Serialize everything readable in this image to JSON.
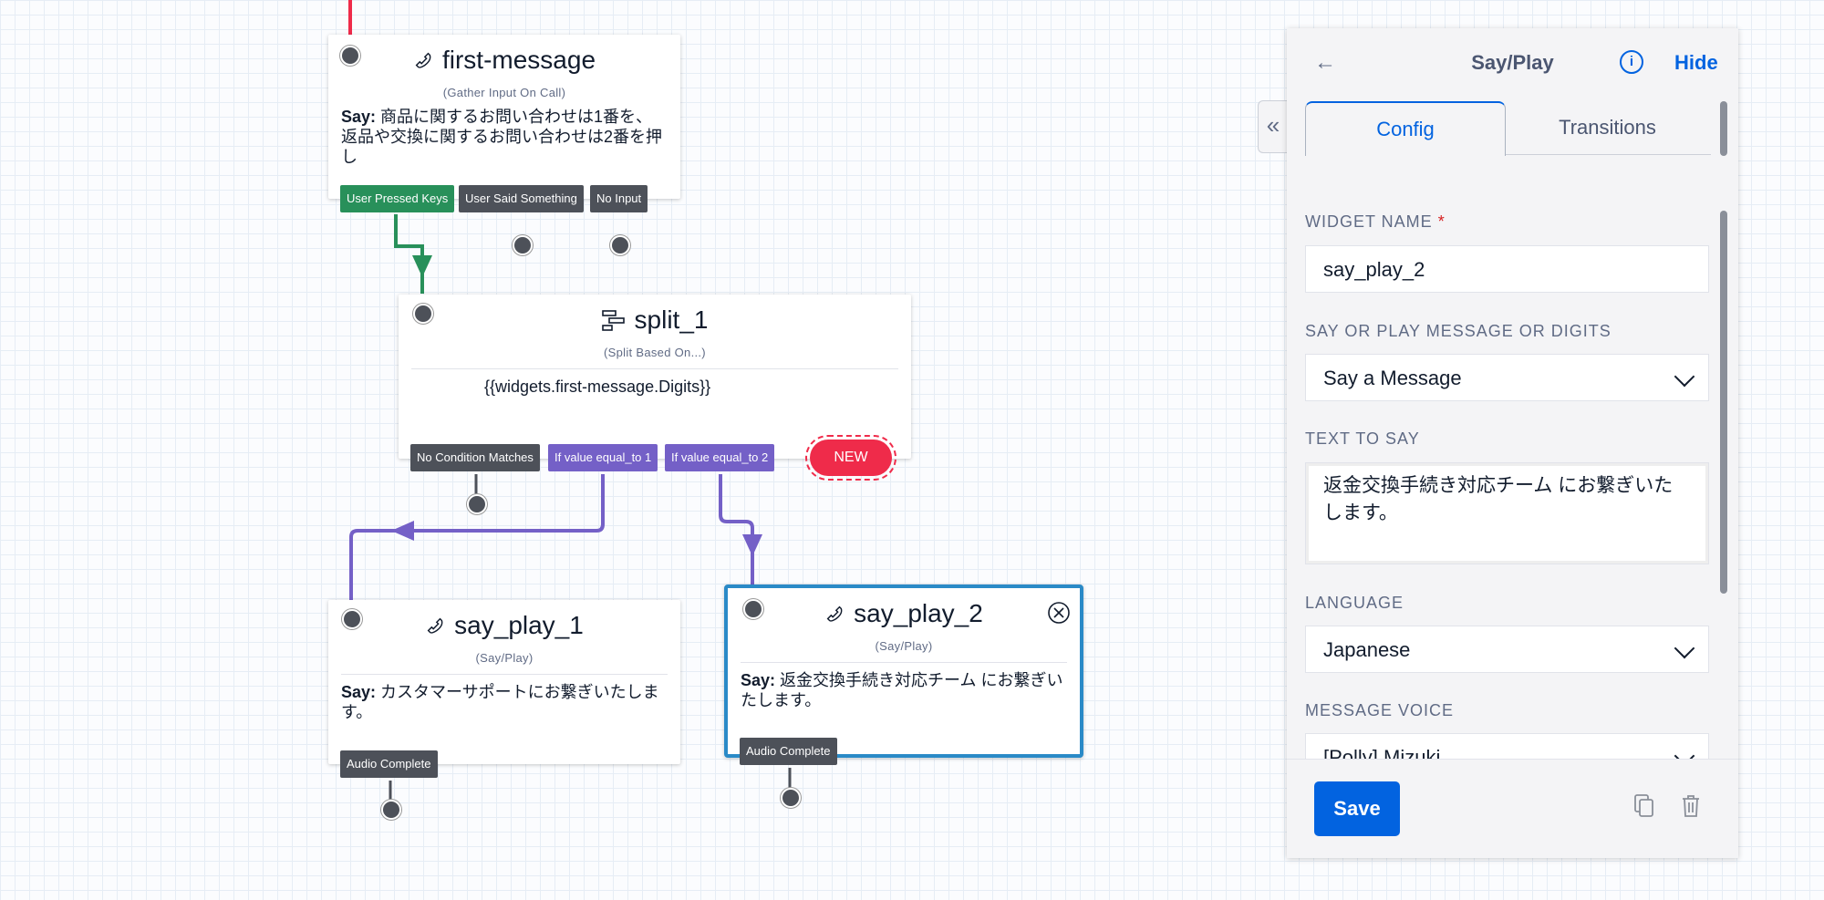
{
  "canvas": {
    "nodes": {
      "first_message": {
        "title": "first-message",
        "type": "(Gather Input On Call)",
        "say_label": "Say:",
        "say_text": "商品に関するお問い合わせは1番を、返品や交換に関するお問い合わせは2番を押し",
        "transitions": [
          "User Pressed Keys",
          "User Said Something",
          "No Input"
        ]
      },
      "split_1": {
        "title": "split_1",
        "type": "(Split Based On...)",
        "expression": "{{widgets.first-message.Digits}}",
        "transitions": [
          "No Condition Matches",
          "If value equal_to 1",
          "If value equal_to 2"
        ],
        "new_label": "NEW"
      },
      "say_play_1": {
        "title": "say_play_1",
        "type": "(Say/Play)",
        "say_label": "Say:",
        "say_text": "カスタマーサポートにお繋ぎいたします。",
        "transitions": [
          "Audio Complete"
        ]
      },
      "say_play_2": {
        "title": "say_play_2",
        "type": "(Say/Play)",
        "say_label": "Say:",
        "say_text": "返金交換手続き対応チーム にお繋ぎいたします。",
        "transitions": [
          "Audio Complete"
        ]
      }
    },
    "colors": {
      "green": "#28905a",
      "purple": "#7460c7",
      "red": "#ef2b4a",
      "selected": "#2a8ac7"
    }
  },
  "panel": {
    "title": "Say/Play",
    "back_icon": "arrow-left-icon",
    "info_icon": "info-icon",
    "hide_label": "Hide",
    "collapse_icon": "double-chevron-left-icon",
    "tabs": [
      {
        "label": "Config",
        "active": true
      },
      {
        "label": "Transitions",
        "active": false
      }
    ],
    "fields": {
      "widget_name": {
        "label": "WIDGET NAME",
        "required": "*",
        "value": "say_play_2"
      },
      "say_or_play": {
        "label": "SAY OR PLAY MESSAGE OR DIGITS",
        "value": "Say a Message"
      },
      "text_to_say": {
        "label": "TEXT TO SAY",
        "value": "返金交換手続き対応チーム にお繋ぎいたします。"
      },
      "language": {
        "label": "LANGUAGE",
        "value": "Japanese"
      },
      "message_voice": {
        "label": "MESSAGE VOICE",
        "value": "[Polly] Mizuki"
      }
    },
    "footer": {
      "save_label": "Save",
      "duplicate_icon": "copy-icon",
      "delete_icon": "trash-icon"
    }
  }
}
